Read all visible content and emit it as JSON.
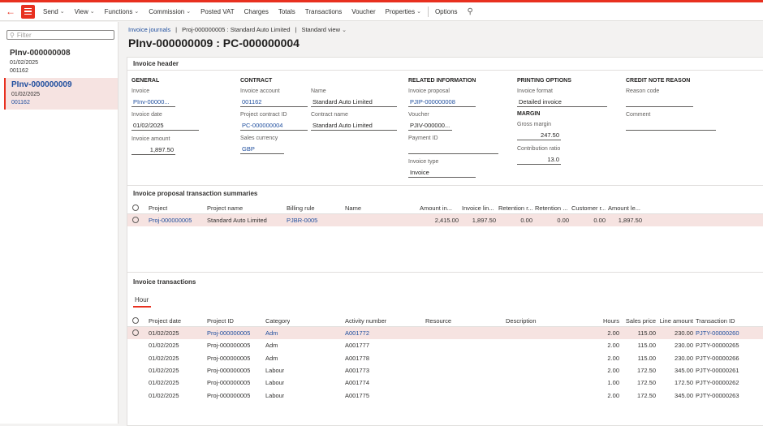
{
  "toolbar": {
    "send": "Send",
    "view": "View",
    "functions": "Functions",
    "commission": "Commission",
    "posted_vat": "Posted VAT",
    "charges": "Charges",
    "totals": "Totals",
    "transactions": "Transactions",
    "voucher": "Voucher",
    "properties": "Properties",
    "options": "Options"
  },
  "left": {
    "filter_placeholder": "Filter",
    "items": [
      {
        "title": "PInv-000000008",
        "date": "01/02/2025",
        "account": "001162"
      },
      {
        "title": "PInv-000000009",
        "date": "01/02/2025",
        "account": "001162"
      }
    ]
  },
  "breadcrumb": {
    "link": "Invoice journals",
    "proj": "Proj-000000005 : Standard Auto Limited",
    "sep": "|",
    "view": "Standard view"
  },
  "title": "PInv-000000009 : PC-000000004",
  "header": {
    "card_title": "Invoice header",
    "general": "GENERAL",
    "invoice_label": "Invoice",
    "invoice_value": "PInv-00000...",
    "invoice_date_label": "Invoice date",
    "invoice_date_value": "01/02/2025",
    "invoice_amount_label": "Invoice amount",
    "invoice_amount_value": "1,897.50",
    "contract": "CONTRACT",
    "invoice_account_label": "Invoice account",
    "invoice_account_value": "001162",
    "name_label": "Name",
    "name_value": "Standard Auto Limited",
    "project_contract_label": "Project contract ID",
    "project_contract_value": "PC-000000004",
    "contract_name_label": "Contract name",
    "contract_name_value": "Standard Auto Limited",
    "sales_currency_label": "Sales currency",
    "sales_currency_value": "GBP",
    "related": "RELATED INFORMATION",
    "invoice_proposal_label": "Invoice proposal",
    "invoice_proposal_value": "PJIP-000000008",
    "voucher_label": "Voucher",
    "voucher_value": "PJIV-000000...",
    "payment_id_label": "Payment ID",
    "payment_id_value": "",
    "invoice_type_label": "Invoice type",
    "invoice_type_value": "Invoice",
    "printing": "PRINTING OPTIONS",
    "invoice_format_label": "Invoice format",
    "invoice_format_value": "Detailed invoice",
    "margin": "MARGIN",
    "gross_margin_label": "Gross margin",
    "gross_margin_value": "247.50",
    "contribution_label": "Contribution ratio",
    "contribution_value": "13.0",
    "credit_note": "CREDIT NOTE REASON",
    "reason_code_label": "Reason code",
    "comment_label": "Comment"
  },
  "proposal": {
    "card_title": "Invoice proposal transaction summaries",
    "columns": [
      "Project",
      "Project name",
      "Billing rule",
      "Name",
      "Amount in...",
      "Invoice lin...",
      "Retention r...",
      "Retention ...",
      "Customer r...",
      "Amount le..."
    ],
    "rows": [
      [
        "Proj-000000005",
        "Standard Auto Limited",
        "PJBR-0005",
        "",
        "2,415.00",
        "1,897.50",
        "0.00",
        "0.00",
        "0.00",
        "1,897.50"
      ]
    ]
  },
  "transactions": {
    "card_title": "Invoice transactions",
    "tab": "Hour",
    "columns": [
      "Project date",
      "Project ID",
      "Category",
      "Activity number",
      "Resource",
      "Description",
      "Hours",
      "Sales price",
      "Line amount",
      "Transaction ID"
    ],
    "rows": [
      [
        "01/02/2025",
        "Proj-000000005",
        "Adm",
        "A001772",
        "",
        "",
        "2.00",
        "115.00",
        "230.00",
        "PJTY-00000260"
      ],
      [
        "01/02/2025",
        "Proj-000000005",
        "Adm",
        "A001777",
        "",
        "",
        "2.00",
        "115.00",
        "230.00",
        "PJTY-00000265"
      ],
      [
        "01/02/2025",
        "Proj-000000005",
        "Adm",
        "A001778",
        "",
        "",
        "2.00",
        "115.00",
        "230.00",
        "PJTY-00000266"
      ],
      [
        "01/02/2025",
        "Proj-000000005",
        "Labour",
        "A001773",
        "",
        "",
        "2.00",
        "172.50",
        "345.00",
        "PJTY-00000261"
      ],
      [
        "01/02/2025",
        "Proj-000000005",
        "Labour",
        "A001774",
        "",
        "",
        "1.00",
        "172.50",
        "172.50",
        "PJTY-00000262"
      ],
      [
        "01/02/2025",
        "Proj-000000005",
        "Labour",
        "A001775",
        "",
        "",
        "2.00",
        "172.50",
        "345.00",
        "PJTY-00000263"
      ]
    ]
  },
  "colors": {
    "accent": "#e8301f",
    "link": "#1f4e9e",
    "selected_row": "#f6e3e1"
  }
}
